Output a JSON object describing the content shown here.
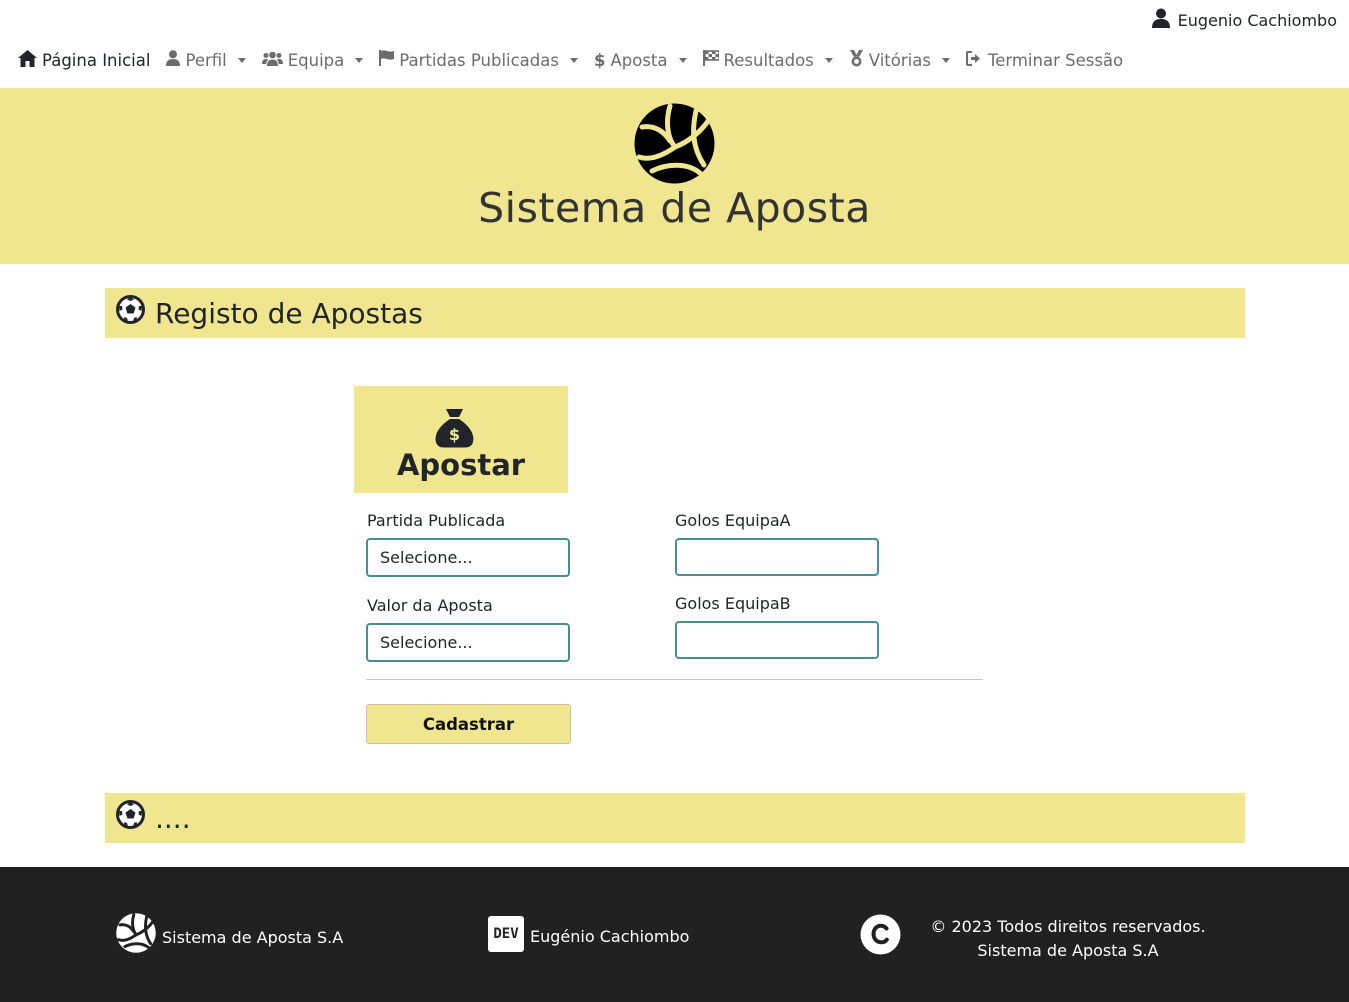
{
  "user": {
    "name": "Eugenio Cachiombo",
    "icon": "user-icon"
  },
  "nav": {
    "home": "Página Inicial",
    "perfil": "Perfil",
    "equipa": "Equipa",
    "partidas": "Partidas Publicadas",
    "aposta": "Aposta",
    "resultados": "Resultados",
    "vitorias": "Vitórias",
    "logout": "Terminar Sessão"
  },
  "hero": {
    "title": "Sistema de Aposta",
    "icon": "volleyball-icon"
  },
  "section": {
    "title": "Registo de Apostas",
    "icon": "futbol-icon"
  },
  "form": {
    "title": "Apostar",
    "icon": "money-bag-icon",
    "partida_label": "Partida Publicada",
    "partida_value": "Selecione...",
    "valor_label": "Valor da Aposta",
    "valor_value": "Selecione...",
    "golos_a_label": "Golos EquipaA",
    "golos_a_value": "",
    "golos_b_label": "Golos EquipaB",
    "golos_b_value": "",
    "submit": "Cadastrar"
  },
  "section2": {
    "title": "...."
  },
  "footer": {
    "brand": "Sistema de Aposta S.A",
    "dev_badge": "DEV",
    "dev_name": "Eugénio Cachiombo",
    "copyright_line1": "© 2023 Todos direitos reservados.",
    "copyright_line2": "Sistema de Aposta S.A"
  },
  "colors": {
    "accent": "#efe68f",
    "footer_bg": "#212121",
    "field_border": "#4a8f8f"
  }
}
